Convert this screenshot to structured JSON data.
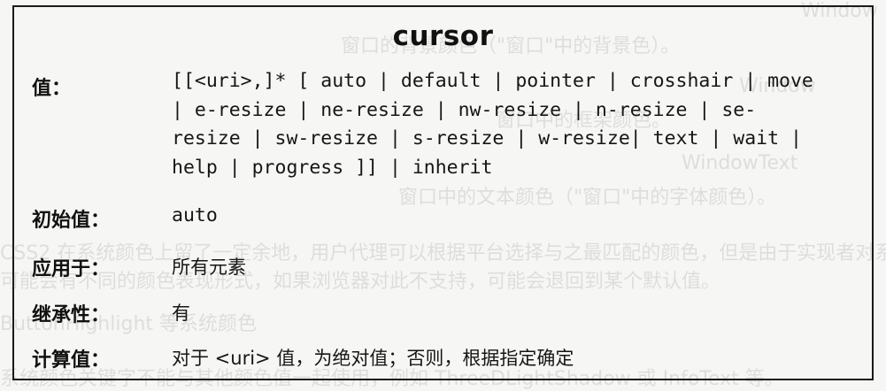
{
  "title": "cursor",
  "rows": [
    {
      "label": "值：",
      "lines": [
        "[[<uri>,]* [ auto | default | pointer | crosshair | move",
        "| e-resize | ne-resize | nw-resize | n-resize | se-",
        "resize | sw-resize | s-resize | w-resize| text | wait |",
        "help | progress ]] | inherit"
      ]
    },
    {
      "label": "初始值：",
      "value": "auto"
    },
    {
      "label": "应用于：",
      "value": "所有元素"
    },
    {
      "label": "继承性：",
      "value": "有"
    },
    {
      "label": "计算值：",
      "value": "对于 <uri> 值，为绝对值；否则，根据指定确定"
    }
  ]
}
